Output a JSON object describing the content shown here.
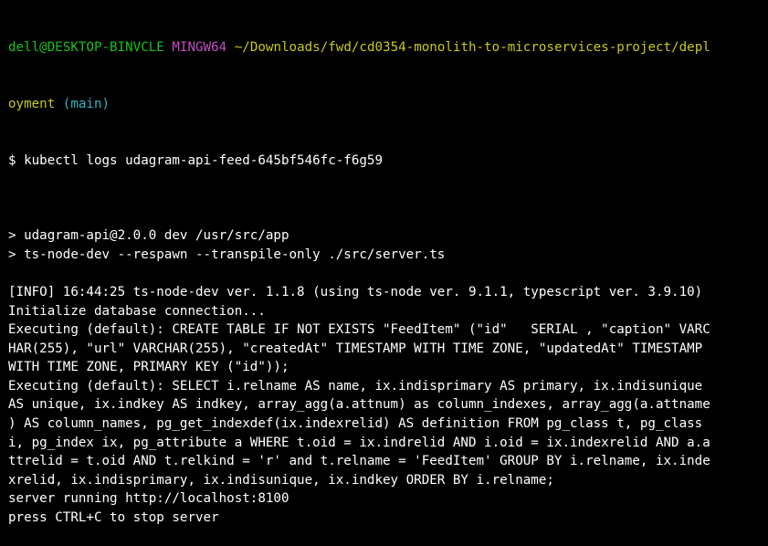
{
  "prompt": {
    "user_host": "dell@DESKTOP-BINVCLE",
    "shell": "MINGW64",
    "path_line1": "~/Downloads/fwd/cd0354-monolith-to-microservices-project/depl",
    "path_line2": "oyment",
    "branch": "(main)",
    "symbol": "$",
    "command": "kubectl logs udagram-api-feed-645bf546fc-f6g59"
  },
  "output_lines": [
    "",
    "> udagram-api@2.0.0 dev /usr/src/app",
    "> ts-node-dev --respawn --transpile-only ./src/server.ts",
    "",
    "[INFO] 16:44:25 ts-node-dev ver. 1.1.8 (using ts-node ver. 9.1.1, typescript ver. 3.9.10)",
    "Initialize database connection...",
    "Executing (default): CREATE TABLE IF NOT EXISTS \"FeedItem\" (\"id\"   SERIAL , \"caption\" VARC",
    "HAR(255), \"url\" VARCHAR(255), \"createdAt\" TIMESTAMP WITH TIME ZONE, \"updatedAt\" TIMESTAMP",
    "WITH TIME ZONE, PRIMARY KEY (\"id\"));",
    "Executing (default): SELECT i.relname AS name, ix.indisprimary AS primary, ix.indisunique",
    "AS unique, ix.indkey AS indkey, array_agg(a.attnum) as column_indexes, array_agg(a.attname",
    ") AS column_names, pg_get_indexdef(ix.indexrelid) AS definition FROM pg_class t, pg_class",
    "i, pg_index ix, pg_attribute a WHERE t.oid = ix.indrelid AND i.oid = ix.indexrelid AND a.a",
    "ttrelid = t.oid AND t.relkind = 'r' and t.relname = 'FeedItem' GROUP BY i.relname, ix.inde",
    "xrelid, ix.indisprimary, ix.indisunique, ix.indkey ORDER BY i.relname;",
    "server running http://localhost:8100",
    "press CTRL+C to stop server"
  ],
  "colors": {
    "background": "#000000",
    "user_host": "#19c419",
    "shell": "#c54dc5",
    "path": "#c9c81a",
    "branch": "#2fb5c4",
    "text": "#ffffff"
  }
}
